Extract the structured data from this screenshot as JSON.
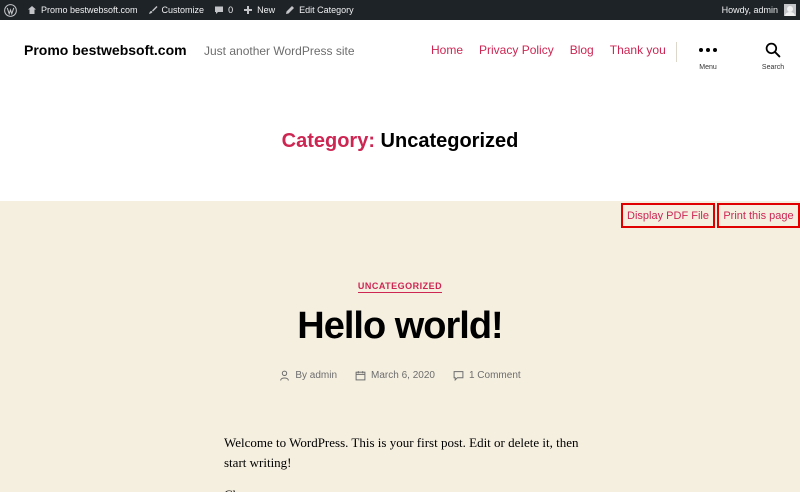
{
  "adminbar": {
    "site_name": "Promo bestwebsoft.com",
    "customize": "Customize",
    "comments_count": "0",
    "new": "New",
    "edit_category": "Edit Category",
    "howdy": "Howdy, admin"
  },
  "header": {
    "site_title": "Promo bestwebsoft.com",
    "site_description": "Just another WordPress site",
    "nav": [
      "Home",
      "Privacy Policy",
      "Blog",
      "Thank you"
    ],
    "menu_label": "Menu",
    "search_label": "Search"
  },
  "archive": {
    "prefix": "Category:",
    "name": "Uncategorized"
  },
  "toolbar": {
    "pdf_label": "Display PDF File",
    "print_label": "Print this page"
  },
  "post": {
    "category": "UNCATEGORIZED",
    "title": "Hello world!",
    "author": "By admin",
    "date": "March 6, 2020",
    "comments": "1 Comment",
    "body": "Welcome to WordPress. This is your first post. Edit or delete it, then start writing!",
    "body_second": "Ch"
  },
  "colors": {
    "accent": "#cd2653",
    "adminbar_bg": "#1d2327",
    "content_bg": "#f5efe0",
    "button_border": "#e00000"
  },
  "icons": [
    "wordpress-icon",
    "brush-icon",
    "comment-bubble-icon",
    "plus-icon",
    "pencil-icon",
    "avatar-icon",
    "menu-dots-icon",
    "search-icon",
    "person-icon",
    "calendar-icon",
    "comment-icon"
  ]
}
